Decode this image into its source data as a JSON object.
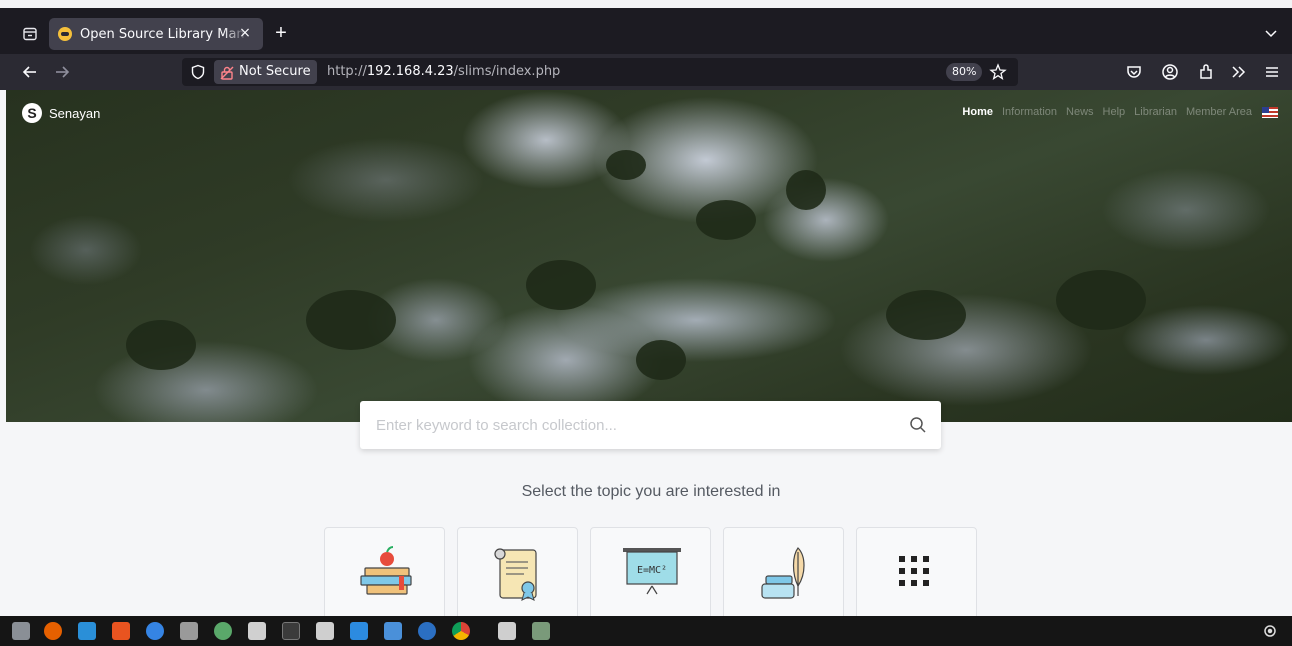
{
  "browser": {
    "tab_title": "Open Source Library Man",
    "tab_close": "×",
    "new_tab": "+",
    "security_label": "Not Secure",
    "url_prefix": "http://",
    "url_host": "192.168.4.23",
    "url_path": "/slims/index.php",
    "zoom": "80%"
  },
  "site": {
    "brand": "Senayan",
    "nav": [
      "Home",
      "Information",
      "News",
      "Help",
      "Librarian",
      "Member Area"
    ]
  },
  "search": {
    "placeholder": "Enter keyword to search collection..."
  },
  "topics": {
    "heading": "Select the topic you are interested in",
    "cards": [
      {
        "icon": "books-apple-icon"
      },
      {
        "icon": "certificate-scroll-icon"
      },
      {
        "icon": "blackboard-emc2-icon",
        "board_text": "E=MC²"
      },
      {
        "icon": "ink-quill-icon"
      },
      {
        "icon": "grid-more-icon"
      }
    ]
  },
  "taskbar": {
    "apps": [
      "files-icon",
      "firefox-icon",
      "notes-icon",
      "software-center-icon",
      "help-icon",
      "screenshot-icon",
      "weather-icon",
      "text-editor-icon",
      "terminal-icon",
      "package-icon",
      "vscode-icon",
      "notepad-icon",
      "browser-icon",
      "chrome-icon",
      "package-icon-2",
      "trash-icon"
    ]
  }
}
